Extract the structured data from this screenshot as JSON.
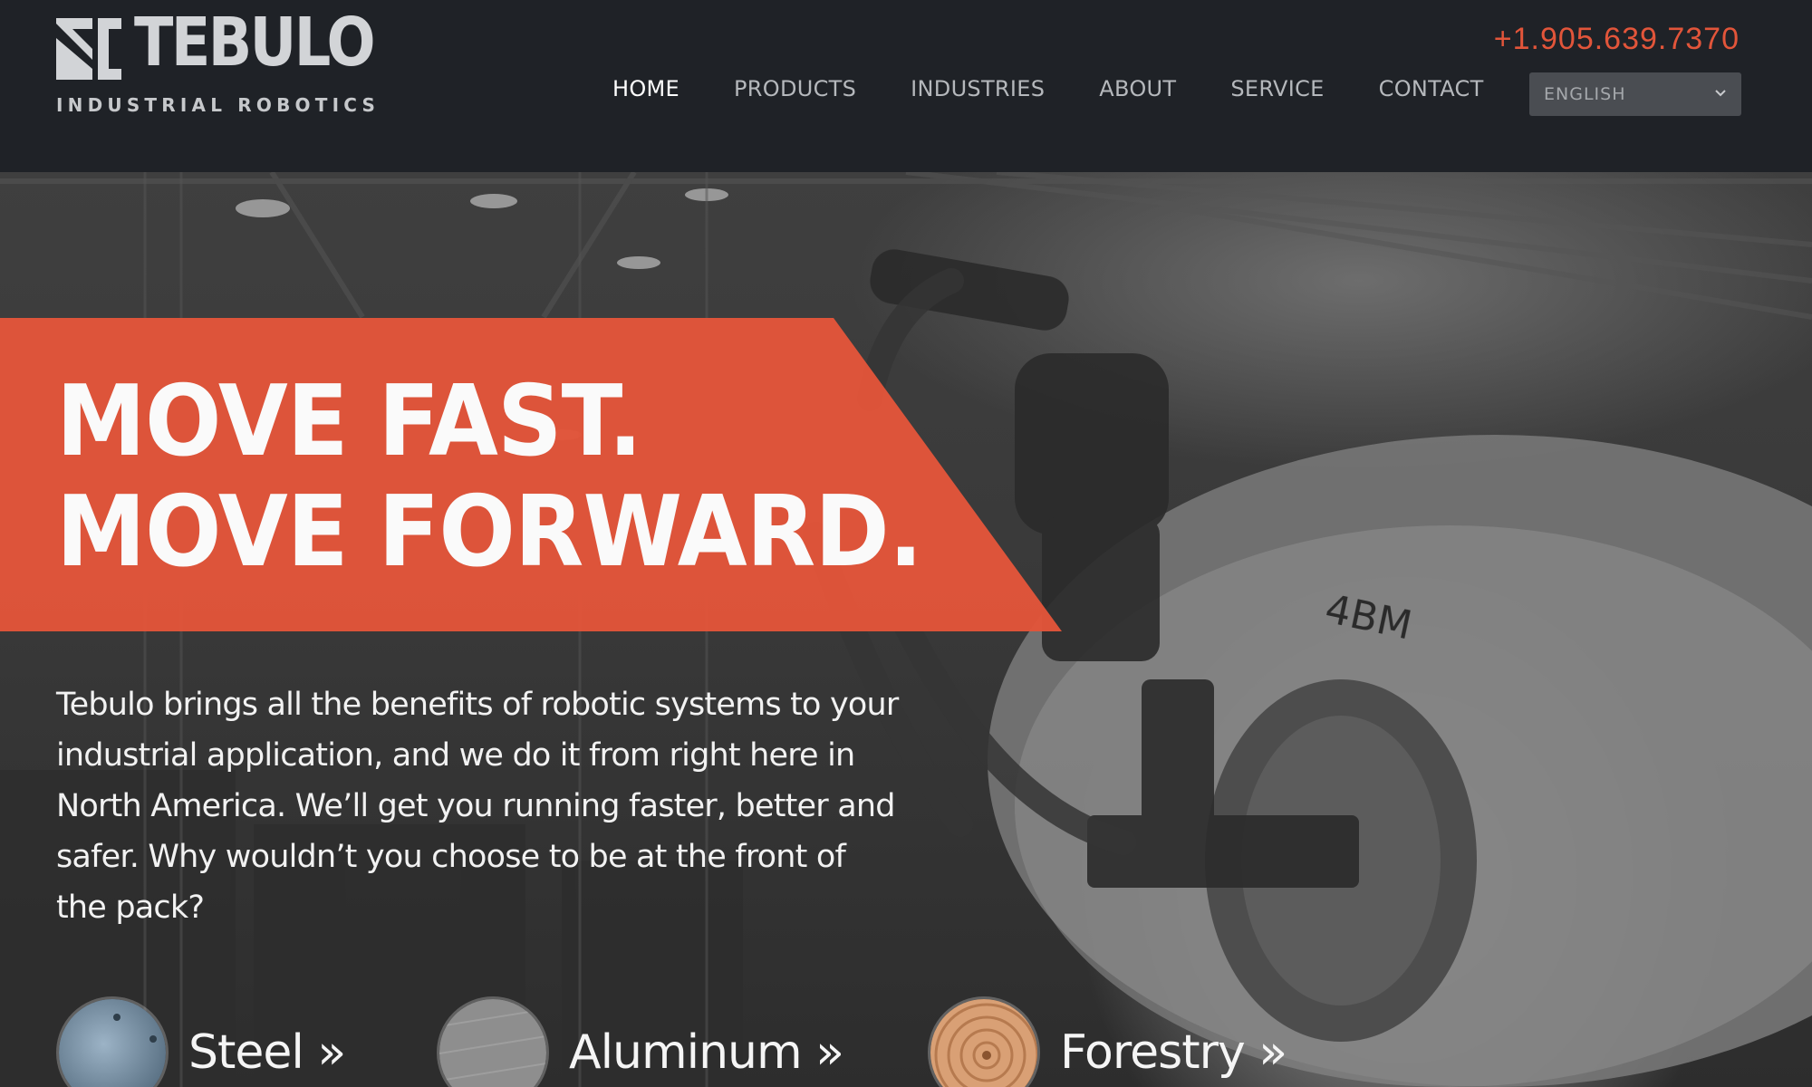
{
  "brand": {
    "name": "TEBULO",
    "tagline": "INDUSTRIAL ROBOTICS",
    "logo_icon": "tebulo-logo-mark"
  },
  "header": {
    "phone": "+1.905.639.7370",
    "nav": [
      {
        "label": "HOME",
        "active": true
      },
      {
        "label": "PRODUCTS",
        "active": false
      },
      {
        "label": "INDUSTRIES",
        "active": false
      },
      {
        "label": "ABOUT",
        "active": false
      },
      {
        "label": "SERVICE",
        "active": false
      },
      {
        "label": "CONTACT",
        "active": false
      }
    ],
    "language": {
      "selected": "ENGLISH",
      "icon": "chevron-down-icon"
    }
  },
  "hero": {
    "headline_line1": "MOVE FAST.",
    "headline_line2": "MOVE FORWARD.",
    "intro": "Tebulo brings all the benefits of robotic systems to your industrial application, and we do it from right here in North America. We’ll get you running faster, better and safer. Why wouldn’t you choose to be at the front of the pack?",
    "background_art": {
      "coil_marking": "4BM"
    }
  },
  "industries": [
    {
      "label": "Steel »"
    },
    {
      "label": "Aluminum »"
    },
    {
      "label": "Forestry »"
    }
  ],
  "colors": {
    "accent": "#e2553a",
    "header_bg": "#1f2227",
    "text_light": "#ffffff"
  }
}
